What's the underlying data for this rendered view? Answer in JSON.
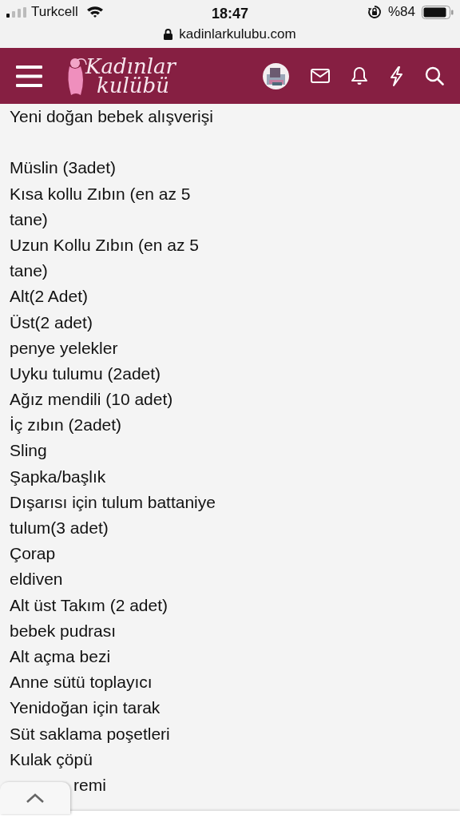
{
  "status_bar": {
    "carrier": "Turkcell",
    "time": "18:47",
    "battery": "%84",
    "url": "kadinlarkulubu.com"
  },
  "header": {
    "logo_lines": [
      "Kadınlar",
      "kulübü"
    ]
  },
  "post": {
    "title": "Yeni doğan bebek alışverişi",
    "lines": [
      "Müslin (3adet)",
      "Kısa kollu Zıbın (en az 5",
      "tane)",
      "Uzun Kollu Zıbın (en az 5",
      "tane)",
      "Alt(2 Adet)",
      "Üst(2 adet)",
      "penye yelekler",
      "Uyku tulumu (2adet)",
      "Ağız mendili (10 adet)",
      "İç zıbın (2adet)",
      "Sling",
      "Şapka/başlık",
      "Dışarısı için tulum battaniye",
      "tulum(3 adet)",
      "Çorap",
      "eldiven",
      "Alt üst Takım (2 adet)",
      "bebek pudrası",
      "Alt açma bezi",
      "Anne sütü toplayıcı",
      "Yenidoğan için tarak",
      "Süt saklama poşetleri",
      "Kulak çöpü"
    ],
    "last_line_visible": "remi"
  }
}
